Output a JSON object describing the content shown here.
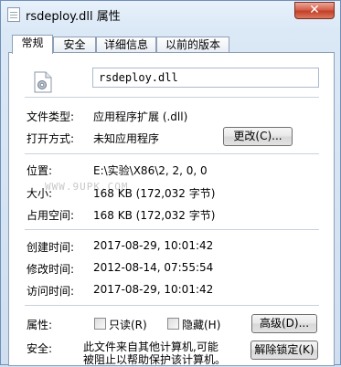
{
  "window": {
    "title": "rsdeploy.dll 属性",
    "close_label": "✕"
  },
  "tabs": [
    {
      "label": "常规",
      "active": true
    },
    {
      "label": "安全",
      "active": false
    },
    {
      "label": "详细信息",
      "active": false
    },
    {
      "label": "以前的版本",
      "active": false
    }
  ],
  "general": {
    "file_name": "rsdeploy.dll",
    "file_type_label": "文件类型:",
    "file_type_value": "应用程序扩展 (.dll)",
    "opens_with_label": "打开方式:",
    "opens_with_value": "未知应用程序",
    "change_button": "更改(C)...",
    "location_label": "位置:",
    "location_value": "E:\\实验\\X86\\2, 2, 0, 0",
    "size_label": "大小:",
    "size_value": "168 KB (172,032 字节)",
    "size_on_disk_label": "占用空间:",
    "size_on_disk_value": "168 KB (172,032 字节)",
    "created_label": "创建时间:",
    "created_value": "2017-08-29, 10:01:42",
    "modified_label": "修改时间:",
    "modified_value": "2012-08-14, 07:55:54",
    "accessed_label": "访问时间:",
    "accessed_value": "2017-08-29, 10:01:42",
    "attributes_label": "属性:",
    "readonly_label": "只读(R)",
    "hidden_label": "隐藏(H)",
    "advanced_button": "高级(D)...",
    "security_label": "安全:",
    "security_text_line1": "此文件来自其他计算机,可能",
    "security_text_line2": "被阻止以帮助保护该计算机。",
    "unblock_button": "解除锁定(K)"
  },
  "watermark": "WWW.9UPK.COM"
}
